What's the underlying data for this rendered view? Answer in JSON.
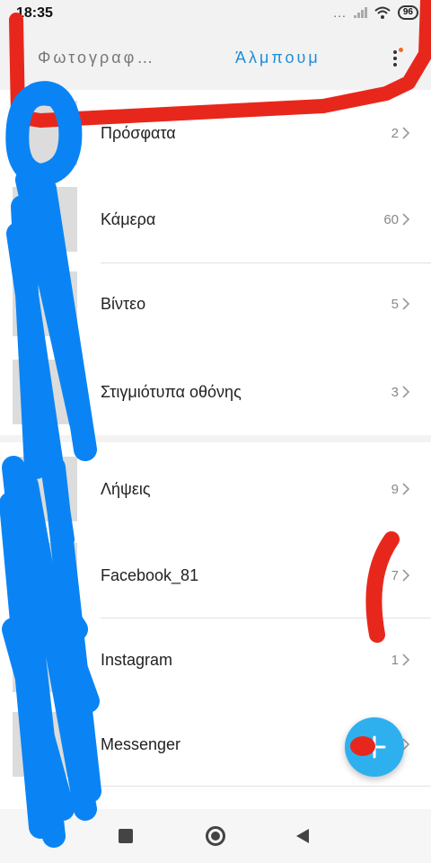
{
  "status_bar": {
    "time": "18:35",
    "dots": "...",
    "battery": "96"
  },
  "app_bar": {
    "tab_photos": "Φωτογραφ…",
    "tab_albums": "Άλμπουμ"
  },
  "albums": [
    {
      "name": "Πρόσφατα",
      "count": "2"
    },
    {
      "name": "Κάμερα",
      "count": "60"
    },
    {
      "name": "Βίντεο",
      "count": "5"
    },
    {
      "name": "Στιγμιότυπα οθόνης",
      "count": "3"
    },
    {
      "name": "Λήψεις",
      "count": "9"
    },
    {
      "name": "Facebook_81",
      "count": "7"
    },
    {
      "name": "Instagram",
      "count": "1"
    },
    {
      "name": "Messenger",
      "count": ""
    }
  ],
  "colors": {
    "accent": "#1e8ed8",
    "fab": "#2eb0ee",
    "scribble_red": "#e8271c",
    "scribble_blue": "#0a84f5"
  },
  "icons": {
    "menu": "more-vertical-icon",
    "chevron": "chevron-right-icon",
    "fab": "add-icon",
    "nav_recents": "square-icon",
    "nav_home": "home-circle-icon",
    "nav_back": "back-triangle-icon"
  }
}
